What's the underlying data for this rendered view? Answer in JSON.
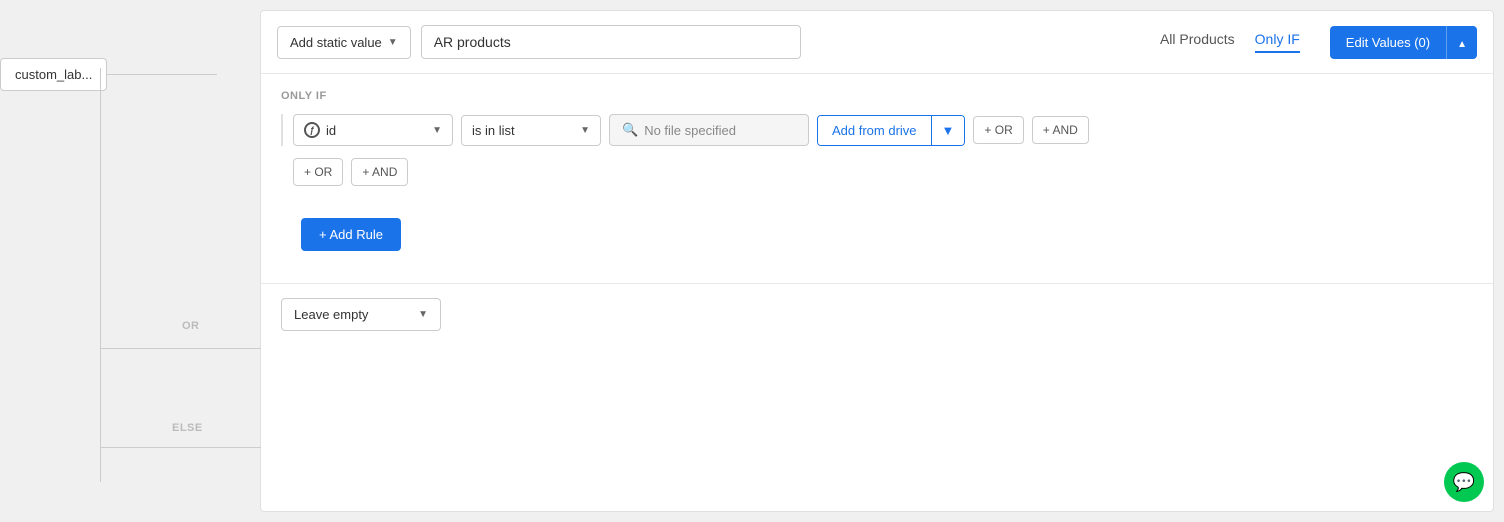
{
  "left_node": {
    "label": "custom_lab..."
  },
  "header": {
    "add_static_label": "Add static value",
    "ar_products_value": "AR products",
    "tab_all_products": "All Products",
    "tab_only_if": "Only IF",
    "edit_values_label": "Edit Values (0)"
  },
  "only_if": {
    "section_label": "ONLY IF",
    "field_label": "id",
    "condition_label": "is in list",
    "file_placeholder": "No file specified",
    "add_from_drive_label": "Add from drive",
    "or_label": "+ OR",
    "and_label": "+ AND"
  },
  "inline_or_and": {
    "or_label": "+ OR",
    "and_label": "+ AND"
  },
  "add_rule": {
    "label": "+ Add Rule"
  },
  "else_section": {
    "label": "ELSE",
    "leave_empty_label": "Leave empty"
  },
  "labels": {
    "or": "OR",
    "else": "ELSE"
  },
  "chat": {
    "icon": "💬"
  }
}
